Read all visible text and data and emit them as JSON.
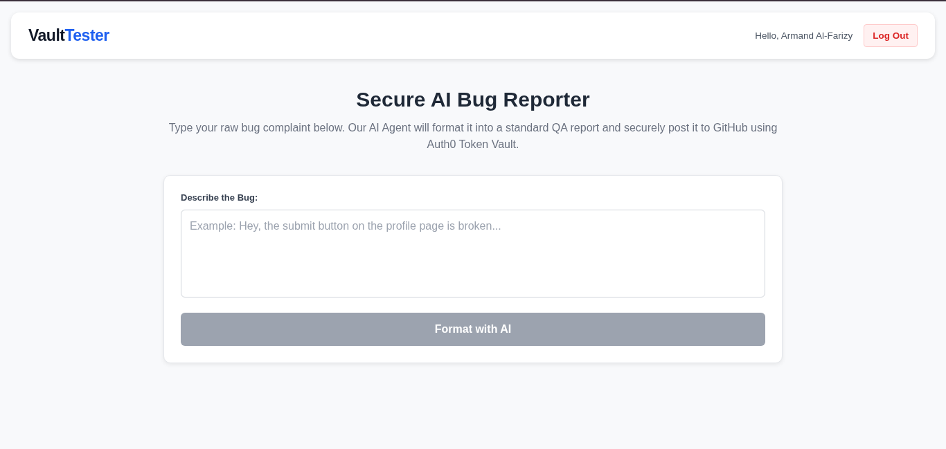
{
  "header": {
    "logo": {
      "primary": "Vault",
      "accent": "Tester"
    },
    "greeting": "Hello, Armand Al-Farizy",
    "logout_button": "Log Out"
  },
  "hero": {
    "title": "Secure AI Bug Reporter",
    "subtitle": "Type your raw bug complaint below. Our AI Agent will format it into a standard QA report and securely post it to GitHub using Auth0 Token Vault."
  },
  "form": {
    "label": "Describe the Bug:",
    "field": {
      "placeholder": "Example: Hey, the submit button on the profile page is broken..."
    },
    "submit_button": {
      "label": "Format with AI",
      "disabled": true
    }
  }
}
